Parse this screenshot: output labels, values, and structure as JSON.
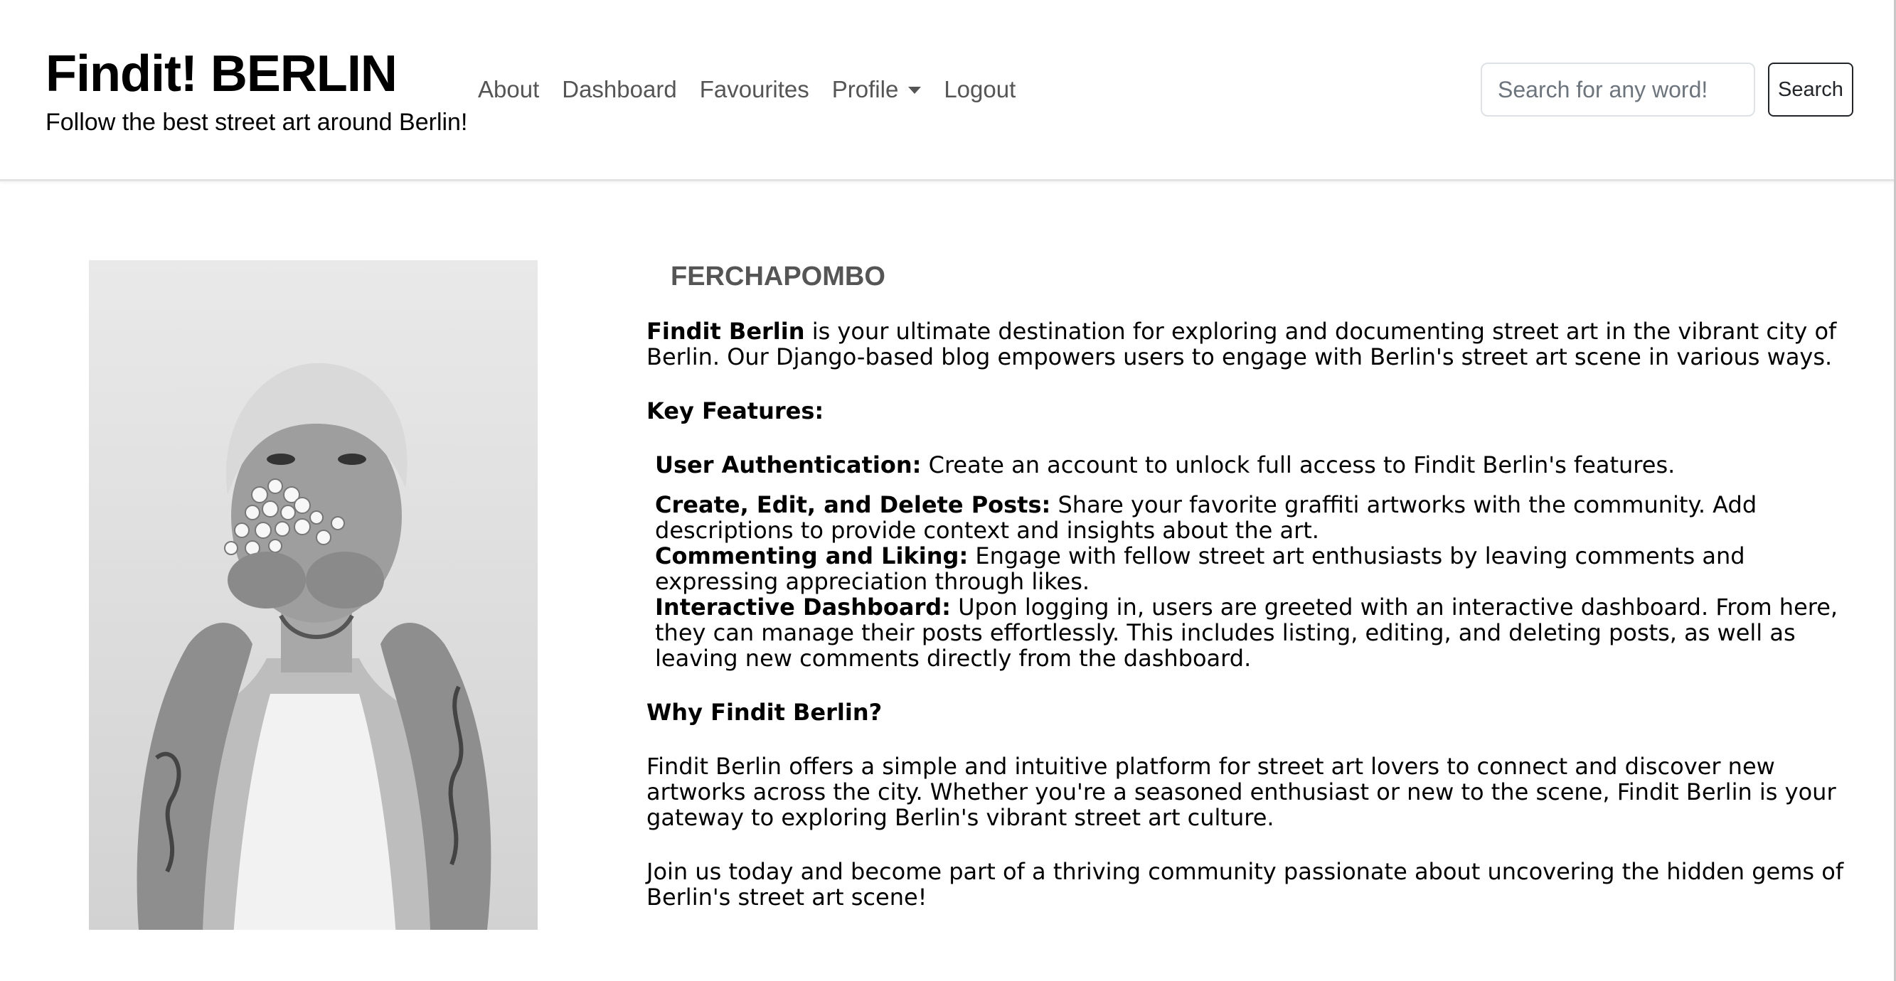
{
  "navbar": {
    "brand_title": "Findit! BERLIN",
    "brand_tagline": "Follow the best street art around Berlin!",
    "links": {
      "about": "About",
      "dashboard": "Dashboard",
      "favourites": "Favourites",
      "profile": "Profile",
      "logout": "Logout"
    },
    "search": {
      "placeholder": "Search for any word!",
      "value": "",
      "button_label": "Search"
    }
  },
  "profile": {
    "username": "FERCHAPOMBO",
    "intro_bold": "Findit Berlin",
    "intro_rest": " is your ultimate destination for exploring and documenting street art in the vibrant city of Berlin. Our Django-based blog empowers users to engage with Berlin's street art scene in various ways.",
    "key_features_heading": "Key Features:",
    "features": [
      {
        "name": "User Authentication:",
        "text": " Create an account to unlock full access to Findit Berlin's features."
      },
      {
        "name": "Create, Edit, and Delete Posts:",
        "text": " Share your favorite graffiti artworks with the community. Add descriptions to provide context and insights about the art."
      },
      {
        "name": "Commenting and Liking:",
        "text": " Engage with fellow street art enthusiasts by leaving comments and expressing appreciation through likes."
      },
      {
        "name": "Interactive Dashboard:",
        "text": " Upon logging in, users are greeted with an interactive dashboard. From here, they can manage their posts effortlessly. This includes listing, editing, and deleting posts, as well as leaving new comments directly from the dashboard."
      }
    ],
    "why_heading": "Why Findit Berlin?",
    "why_text": "Findit Berlin offers a simple and intuitive platform for street art lovers to connect and discover new artworks across the city. Whether you're a seasoned enthusiast or new to the scene, Findit Berlin is your gateway to exploring Berlin's vibrant street art culture.",
    "join_text": "Join us today and become part of a thriving community passionate about uncovering the hidden gems of Berlin's street art scene!"
  },
  "colors": {
    "nav_link": "#555555",
    "username": "#555555",
    "navbar_border": "#e3e3e3"
  }
}
